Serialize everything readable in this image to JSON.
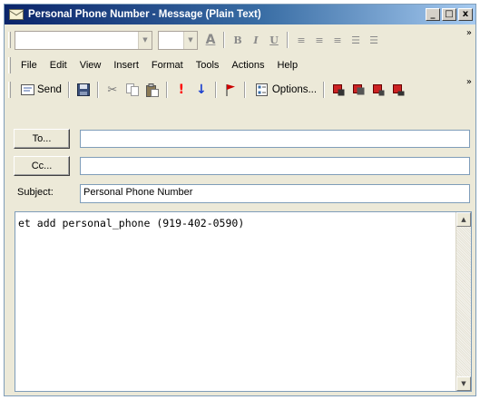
{
  "window": {
    "title": "Personal Phone Number - Message (Plain Text)",
    "min_label": "_",
    "max_label": "□",
    "close_label": "x"
  },
  "menu": {
    "items": [
      "File",
      "Edit",
      "View",
      "Insert",
      "Format",
      "Tools",
      "Actions",
      "Help"
    ]
  },
  "toolbar": {
    "send_label": "Send",
    "options_label": "Options..."
  },
  "format_toolbar": {
    "font_name": "",
    "font_size": "",
    "bold_label": "B",
    "italic_label": "I",
    "underline_label": "U"
  },
  "message": {
    "to_button_label": "To...",
    "cc_button_label": "Cc...",
    "to_value": "",
    "cc_value": "",
    "subject_label": "Subject:",
    "subject_value": "Personal Phone Number",
    "body": "et add personal_phone (919-402-0590)"
  },
  "overflow_label": "»",
  "colors": {
    "title_start": "#0a246a",
    "title_end": "#a6caf0",
    "window_bg": "#ece9d8",
    "importance_high": "#ff0000",
    "importance_low": "#1a3fcf",
    "flag": "#cc0000"
  }
}
